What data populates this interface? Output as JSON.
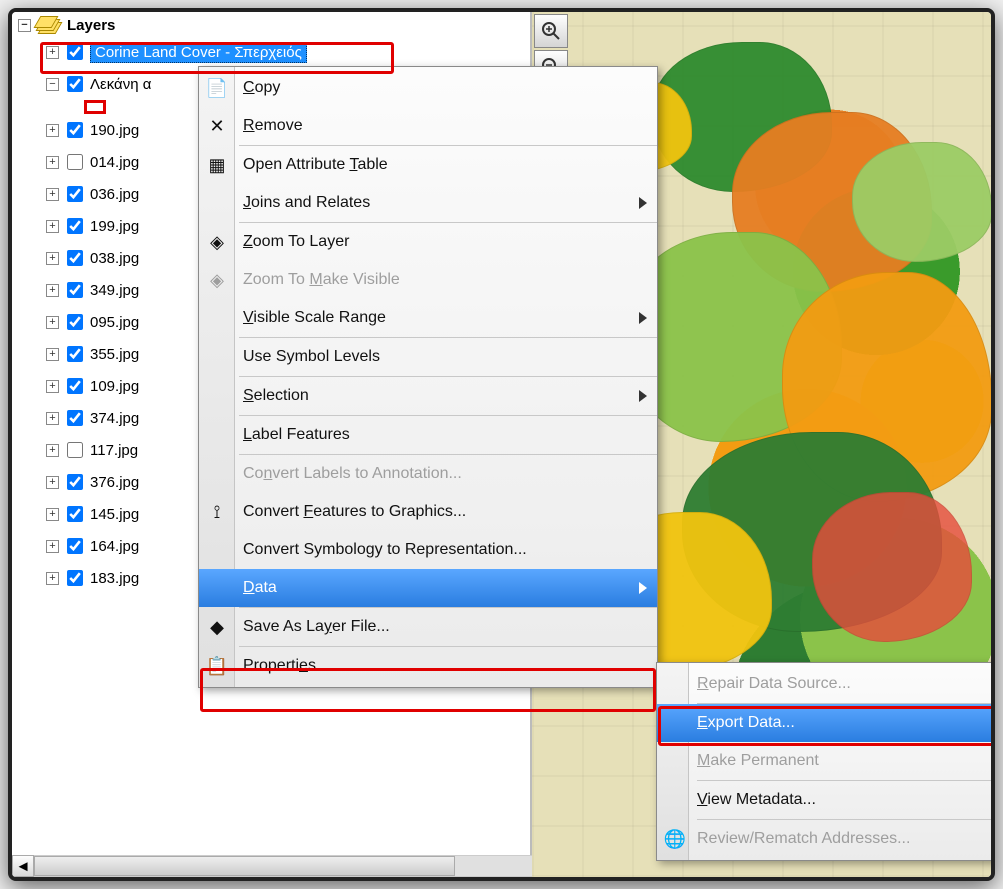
{
  "toc": {
    "header": "Layers",
    "selected_layer": "Corine Land Cover - Σπερχειός",
    "second_layer": "Λεκάνη α",
    "items": [
      {
        "label": "190.jpg",
        "checked": true
      },
      {
        "label": "014.jpg",
        "checked": false
      },
      {
        "label": "036.jpg",
        "checked": true
      },
      {
        "label": "199.jpg",
        "checked": true
      },
      {
        "label": "038.jpg",
        "checked": true
      },
      {
        "label": "349.jpg",
        "checked": true
      },
      {
        "label": "095.jpg",
        "checked": true
      },
      {
        "label": "355.jpg",
        "checked": true
      },
      {
        "label": "109.jpg",
        "checked": true
      },
      {
        "label": "374.jpg",
        "checked": true
      },
      {
        "label": "117.jpg",
        "checked": false
      },
      {
        "label": "376.jpg",
        "checked": true
      },
      {
        "label": "145.jpg",
        "checked": true
      },
      {
        "label": "164.jpg",
        "checked": true
      },
      {
        "label": "183.jpg",
        "checked": true
      }
    ]
  },
  "context_menu": {
    "copy": "Copy",
    "remove": "Remove",
    "open_attr": "Open Attribute Table",
    "joins": "Joins and Relates",
    "zoom_layer": "Zoom To Layer",
    "zoom_visible": "Zoom To Make Visible",
    "visible_scale": "Visible Scale Range",
    "symbol_levels": "Use Symbol Levels",
    "selection": "Selection",
    "label_features": "Label Features",
    "convert_labels": "Convert Labels to Annotation...",
    "convert_features": "Convert Features to Graphics...",
    "convert_symbology": "Convert Symbology to Representation...",
    "data": "Data",
    "save_layer": "Save As Layer File...",
    "properties": "Properties..."
  },
  "sub_menu": {
    "repair": "Repair Data Source...",
    "export": "Export Data...",
    "make_permanent": "Make Permanent",
    "view_metadata": "View Metadata...",
    "review": "Review/Rematch Addresses..."
  },
  "map_tools": {
    "zoom_in": "🔍",
    "zoom_out": "🔍"
  }
}
